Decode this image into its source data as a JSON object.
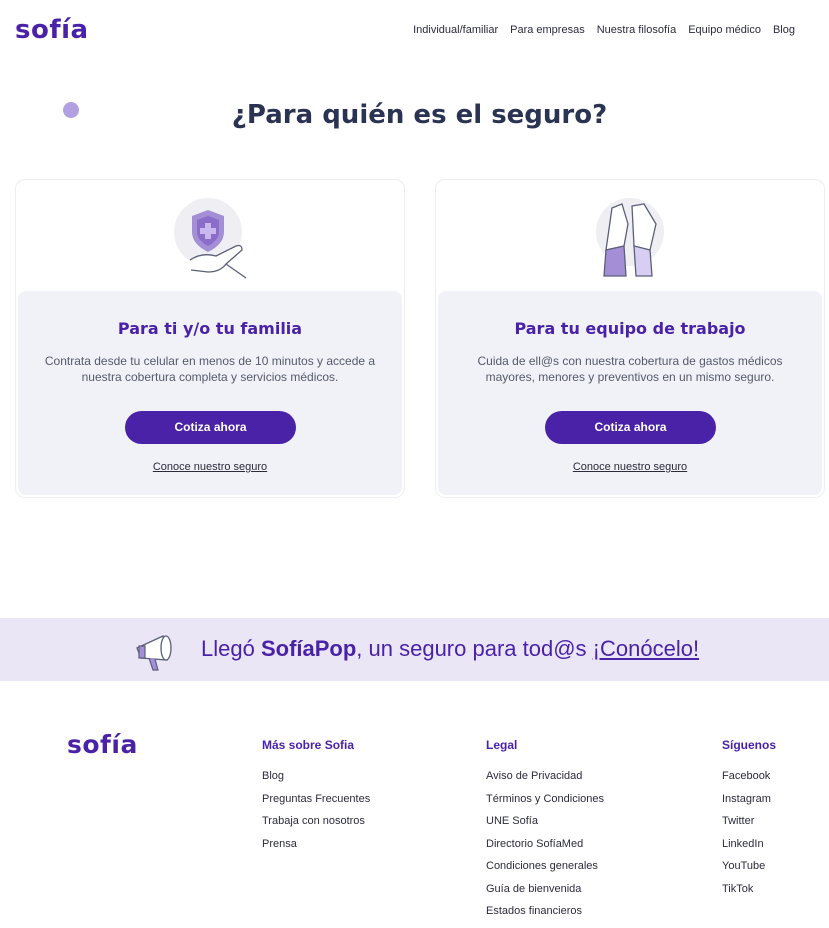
{
  "header": {
    "logo": "sofía",
    "nav": [
      "Individual/familiar",
      "Para empresas",
      "Nuestra filosofía",
      "Equipo médico",
      "Blog"
    ]
  },
  "hero": {
    "title": "¿Para quién es el seguro?"
  },
  "cards": [
    {
      "title": "Para ti y/o tu familia",
      "description": "Contrata desde tu celular en menos de 10 minutos y accede a nuestra cobertura completa y servicios médicos.",
      "cta": "Cotiza ahora",
      "link": "Conoce nuestro seguro",
      "icon": "shield-hand-icon"
    },
    {
      "title": "Para tu equipo de trabajo",
      "description": "Cuida de ell@s con nuestra cobertura de gastos médicos mayores, menores y preventivos en un mismo seguro.",
      "cta": "Cotiza ahora",
      "link": "Conoce nuestro seguro",
      "icon": "high-five-icon"
    }
  ],
  "banner": {
    "prefix": "Llegó ",
    "brand": "SofíaPop",
    "middle": ", un seguro para tod@s ",
    "link": "¡Conócelo!",
    "icon": "megaphone-icon"
  },
  "footer": {
    "logo": "sofía",
    "columns": [
      {
        "title": "Más sobre Sofia",
        "items": [
          "Blog",
          "Preguntas Frecuentes",
          "Trabaja con nosotros",
          "Prensa"
        ]
      },
      {
        "title": "Legal",
        "items": [
          "Aviso de Privacidad",
          "Términos y Condiciones",
          "UNE Sofía",
          "Directorio SofíaMed",
          "Condiciones generales",
          "Guía de bienvenida",
          "Estados financieros"
        ]
      },
      {
        "title": "Síguenos",
        "items": [
          "Facebook",
          "Instagram",
          "Twitter",
          "LinkedIn",
          "YouTube",
          "TikTok"
        ]
      }
    ]
  },
  "colors": {
    "brand": "#4a22a8",
    "banner_bg": "#ebe6f6",
    "card_bg": "#f1f2f7",
    "heading": "#2b3352"
  }
}
